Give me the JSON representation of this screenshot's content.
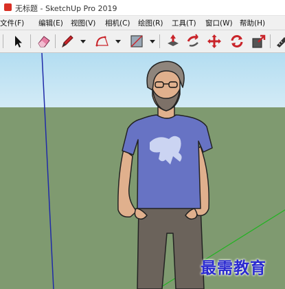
{
  "window": {
    "title": "无标题 - SketchUp Pro 2019"
  },
  "menubar": {
    "items": [
      {
        "label": "文件(F)"
      },
      {
        "label": "编辑(E)"
      },
      {
        "label": "视图(V)"
      },
      {
        "label": "相机(C)"
      },
      {
        "label": "绘图(R)"
      },
      {
        "label": "工具(T)"
      },
      {
        "label": "窗口(W)"
      },
      {
        "label": "帮助(H)"
      }
    ]
  },
  "toolbar": {
    "tools": [
      {
        "name": "select-tool-icon"
      },
      {
        "name": "eraser-tool-icon"
      },
      {
        "name": "pencil-line-tool-icon"
      },
      {
        "name": "arc-tool-icon"
      },
      {
        "name": "rectangle-shape-tool-icon"
      },
      {
        "name": "push-pull-tool-icon"
      },
      {
        "name": "follow-me-tool-icon"
      },
      {
        "name": "move-tool-icon"
      },
      {
        "name": "rotate-tool-icon"
      },
      {
        "name": "scale-tool-icon"
      },
      {
        "name": "tape-measure-tool-icon"
      }
    ]
  },
  "colors": {
    "sky": "#c3e3f3",
    "ground": "#7f9a70",
    "blue_axis": "#1f2aa8",
    "green_axis": "#22b322",
    "shirt": "#6773c4",
    "pants": "#6b635b",
    "skin": "#e0b08d"
  },
  "watermark": {
    "text": "最需教育"
  }
}
